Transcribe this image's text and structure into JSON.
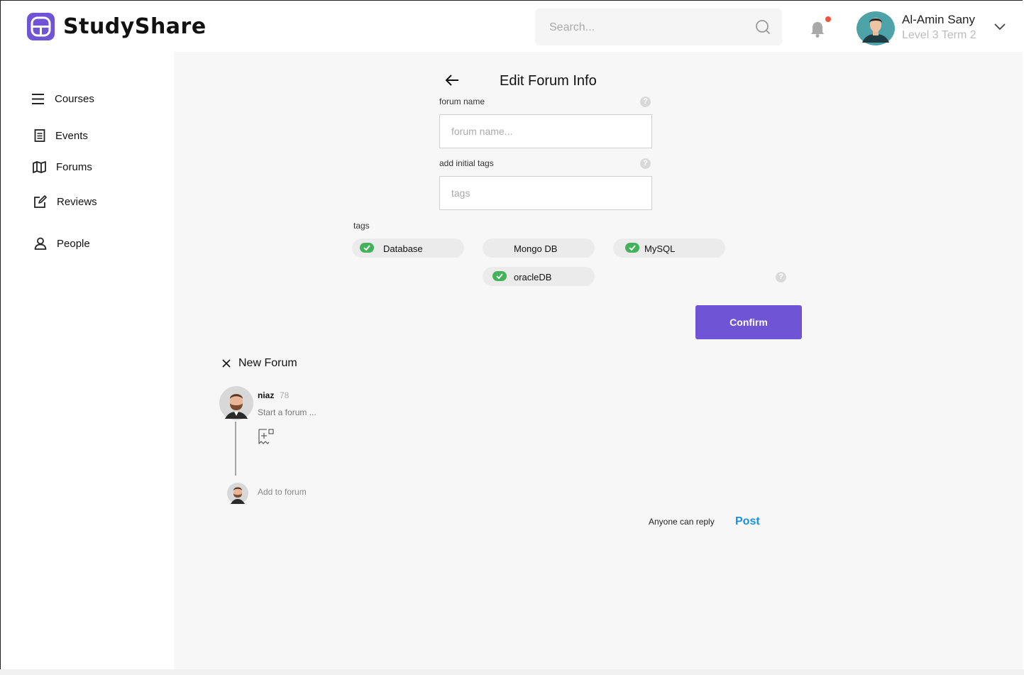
{
  "app": {
    "name": "StudyShare"
  },
  "header": {
    "search_placeholder": "Search...",
    "user_name": "Al-Amin Sany",
    "user_level": "Level 3 Term 2"
  },
  "sidebar": {
    "items": [
      {
        "label": "Courses",
        "icon": "menu-icon"
      },
      {
        "label": "Events",
        "icon": "document-icon"
      },
      {
        "label": "Forums",
        "icon": "map-icon"
      },
      {
        "label": "Reviews",
        "icon": "edit-icon"
      },
      {
        "label": "People",
        "icon": "person-icon"
      }
    ]
  },
  "edit_form": {
    "title": "Edit Forum Info",
    "forum_name_label": "forum name",
    "forum_name_placeholder": "forum name...",
    "tags_label": "add initial tags",
    "tags_placeholder": "tags",
    "tags_section_label": "tags",
    "tags": [
      "Database",
      "Mongo DB",
      "MySQL",
      "oracleDB"
    ],
    "tags_checked": [
      true,
      false,
      true,
      true
    ],
    "confirm_label": "Confirm",
    "help_glyph": "?"
  },
  "new_forum": {
    "title": "New Forum",
    "author": "niaz",
    "author_count": "78",
    "start_placeholder": "Start a forum ...",
    "add_to_forum": "Add to forum",
    "reply_setting": "Anyone can reply",
    "post_label": "Post"
  },
  "colors": {
    "accent": "#6f55d5",
    "post": "#1592e6",
    "check": "#43b25a",
    "notification": "#f4533b"
  }
}
